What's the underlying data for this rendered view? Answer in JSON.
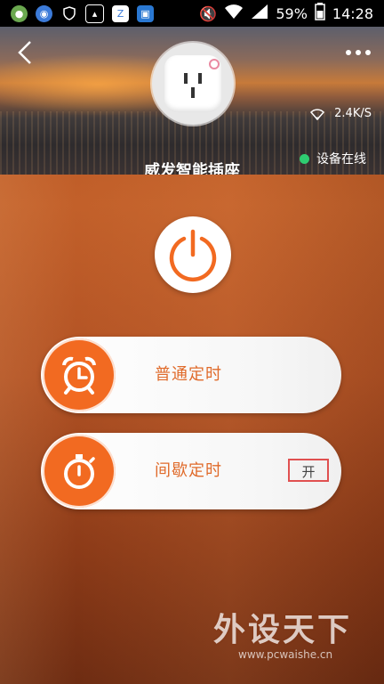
{
  "status_bar": {
    "battery_percent": "59%",
    "time": "14:28"
  },
  "header": {
    "device_name": "威发智能插座",
    "network_speed": "2.4K/S",
    "online_status": "设备在线",
    "online_color": "#2ecc71"
  },
  "controls": {
    "timer_rows": [
      {
        "label": "普通定时",
        "icon": "alarm-clock-icon"
      },
      {
        "label": "间歇定时",
        "icon": "stopwatch-icon",
        "badge": "开"
      }
    ]
  },
  "watermark": {
    "text": "外设天下",
    "url_text": "www.pcwaishe.cn"
  },
  "colors": {
    "accent": "#f26a21",
    "label": "#e06b2b",
    "badge_border": "#e05050"
  }
}
